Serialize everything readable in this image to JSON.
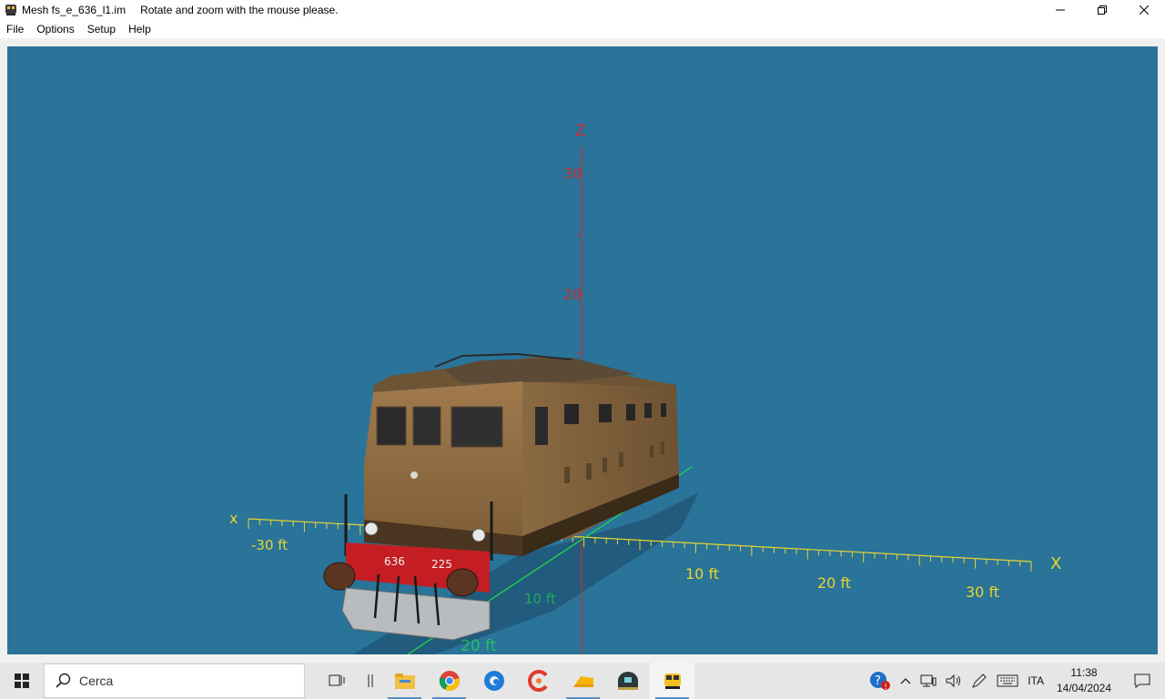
{
  "window": {
    "title": "Mesh fs_e_636_l1.im",
    "hint": "Rotate and zoom with the mouse please.",
    "app_icon": "locomotive-icon",
    "controls": [
      "minimize-icon",
      "restore-icon",
      "close-icon"
    ]
  },
  "menu": [
    {
      "label": "File"
    },
    {
      "label": "Options"
    },
    {
      "label": "Setup"
    },
    {
      "label": "Help"
    }
  ],
  "viewport": {
    "background": "#2a7399",
    "z_axis": {
      "label": "Z",
      "ticks": [
        "20",
        "30"
      ],
      "color": "#c0303a"
    },
    "x_axis": {
      "label": "X",
      "ticks": [
        "10 ft",
        "20 ft",
        "30 ft"
      ],
      "color": "#e6d630"
    },
    "neg_x_axis": {
      "label": "x",
      "ticks": [
        "-30 ft"
      ]
    },
    "y_axis": {
      "ticks": [
        "10 ft",
        "20 ft"
      ],
      "color": "#20e040"
    },
    "model": {
      "number_plate_left": "636",
      "number_plate_right": "225",
      "body_color": "#9a7448",
      "buffer_beam_color": "#c41e24"
    }
  },
  "taskbar": {
    "search_placeholder": "Cerca",
    "apps": [
      "task-view-icon",
      "widgets-icon",
      "file-explorer-icon",
      "chrome-icon",
      "edge-icon",
      "ccleaner-icon",
      "onedrive-icon",
      "game-icon",
      "train-app-icon"
    ],
    "tray": {
      "language": "ITA",
      "time": "11:38",
      "date": "14/04/2024"
    }
  }
}
